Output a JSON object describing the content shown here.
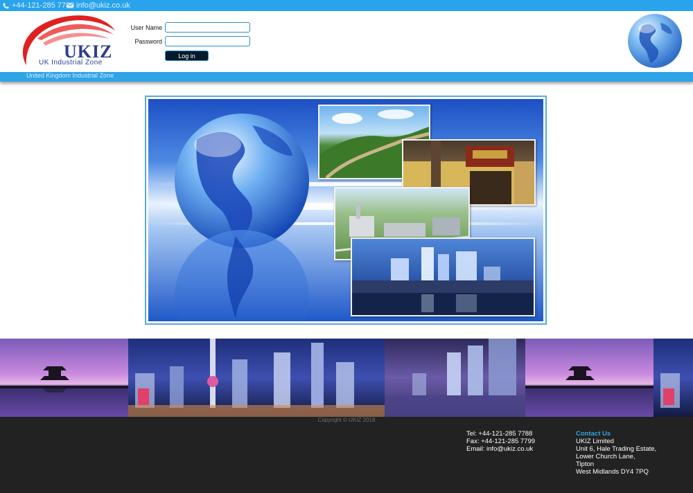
{
  "topbar": {
    "phone": "+44-121-285 7788",
    "email": "info@ukiz.co.uk",
    "icons": [
      "phone-icon",
      "mail-icon"
    ]
  },
  "logo": {
    "text": "UKIZ",
    "subtitle": "UK Industrial Zone"
  },
  "login": {
    "username_label": "User Name",
    "username_value": "",
    "password_label": "Password",
    "password_value": "",
    "button_label": "Log in"
  },
  "strip": {
    "tagline": "United Kingdom Industrial Zone"
  },
  "footer": {
    "copyright": "Copyright © UKIZ 2018",
    "contact_lines": [
      "Tel: +44-121-285 7788",
      "Fax: +44-121-285 7799",
      "Email: info@ukiz.co.uk"
    ],
    "address_heading": "Contact Us",
    "address_lines": [
      "UKIZ Limited",
      "Unit 6, Hale Trading Estate,",
      "Lower Church Lane,",
      "Tipton",
      "West Midlands DY4 7PQ"
    ]
  },
  "colors": {
    "brand_blue": "#29a3ec",
    "footer_bg": "#222222",
    "heading_blue": "#2fa4e7",
    "logo_navy": "#2b3d8f",
    "logo_red": "#e02020"
  }
}
